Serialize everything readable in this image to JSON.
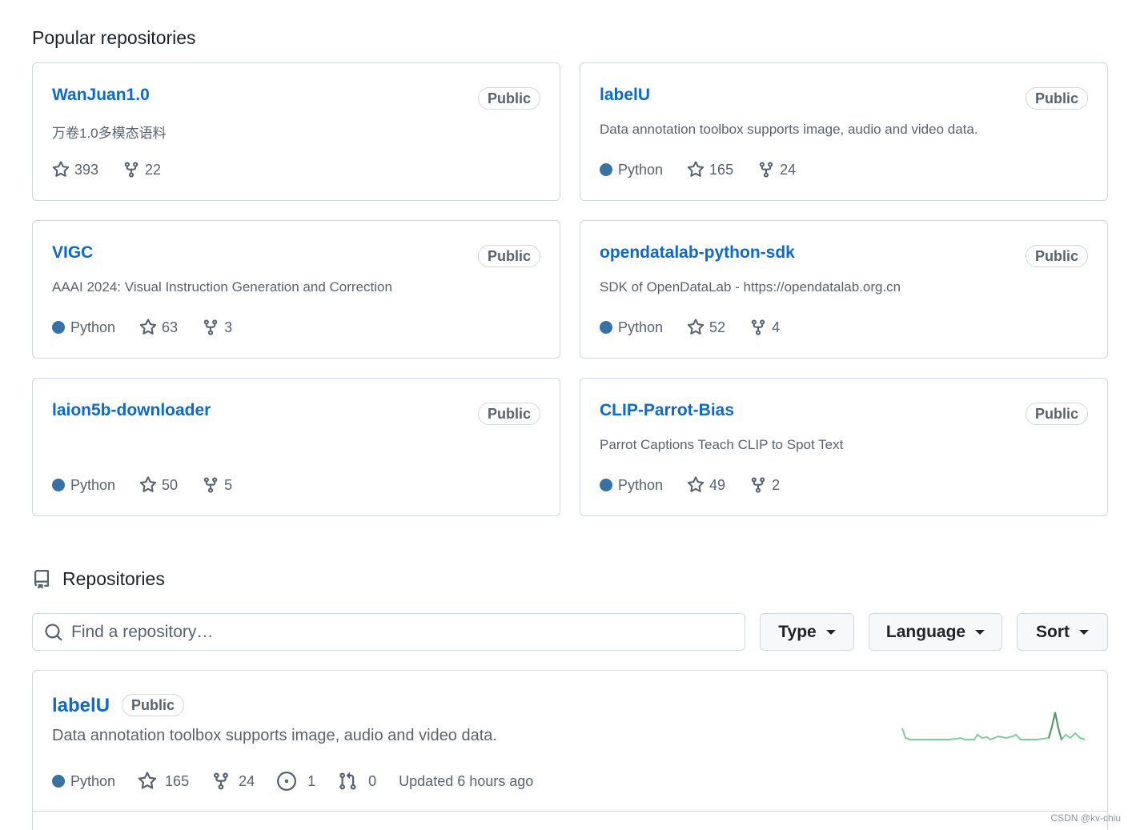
{
  "popular": {
    "title": "Popular repositories",
    "cards": [
      {
        "name": "WanJuan1.0",
        "badge": "Public",
        "description": "万卷1.0多模态语料",
        "language": "",
        "stars": "393",
        "forks": "22"
      },
      {
        "name": "labelU",
        "badge": "Public",
        "description": "Data annotation toolbox supports image, audio and video data.",
        "language": "Python",
        "stars": "165",
        "forks": "24"
      },
      {
        "name": "VIGC",
        "badge": "Public",
        "description": "AAAI 2024: Visual Instruction Generation and Correction",
        "language": "Python",
        "stars": "63",
        "forks": "3"
      },
      {
        "name": "opendatalab-python-sdk",
        "badge": "Public",
        "description": "SDK of OpenDataLab - https://opendatalab.org.cn",
        "language": "Python",
        "stars": "52",
        "forks": "4"
      },
      {
        "name": "laion5b-downloader",
        "badge": "Public",
        "description": "",
        "language": "Python",
        "stars": "50",
        "forks": "5"
      },
      {
        "name": "CLIP-Parrot-Bias",
        "badge": "Public",
        "description": "Parrot Captions Teach CLIP to Spot Text",
        "language": "Python",
        "stars": "49",
        "forks": "2"
      }
    ]
  },
  "repositories": {
    "title": "Repositories",
    "search": {
      "placeholder": "Find a repository…",
      "value": ""
    },
    "filters": {
      "type": "Type",
      "language": "Language",
      "sort": "Sort"
    },
    "items": [
      {
        "name": "labelU",
        "badge": "Public",
        "description": "Data annotation toolbox supports image, audio and video data.",
        "language": "Python",
        "stars": "165",
        "forks": "24",
        "issues": "1",
        "pull_requests": "0",
        "updated": "Updated 6 hours ago"
      }
    ]
  },
  "colors": {
    "link": "#0969da",
    "python": "#3572A5",
    "spark": "#7ccf94"
  },
  "icons": [
    "star-icon",
    "fork-icon",
    "repo-icon",
    "search-icon",
    "issue-icon",
    "pull-request-icon"
  ],
  "watermark": "CSDN @kv-chiu"
}
